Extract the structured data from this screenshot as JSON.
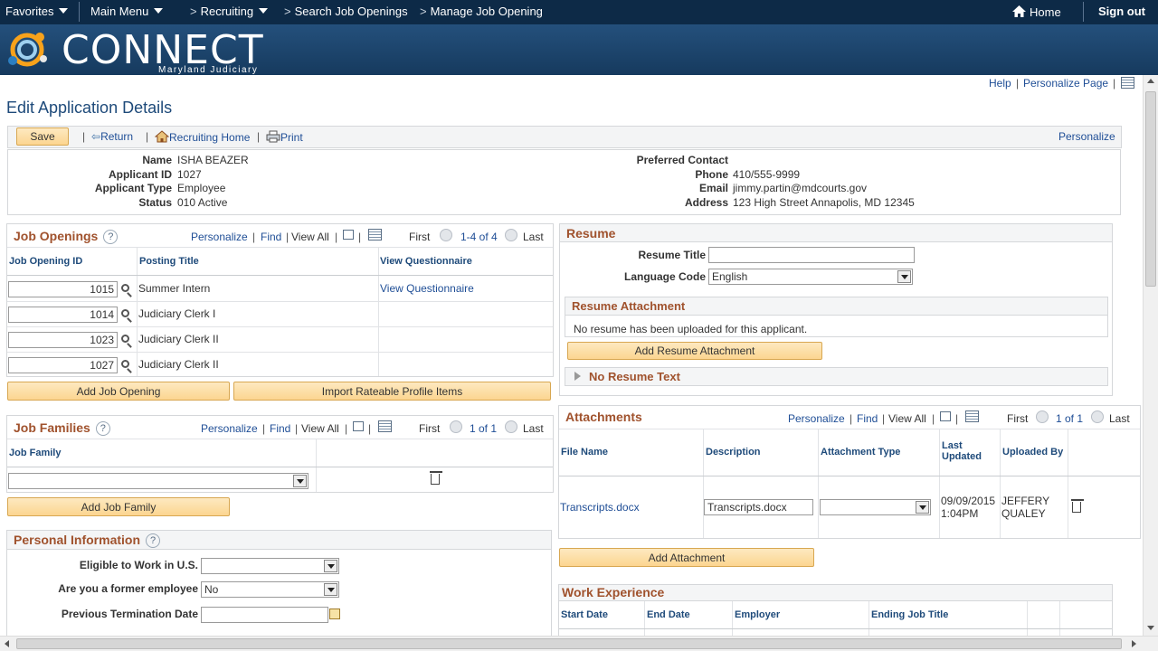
{
  "topnav": {
    "favorites": "Favorites",
    "main_menu": "Main Menu",
    "recruiting": "Recruiting",
    "search_job_openings": "Search Job Openings",
    "manage_job_opening": "Manage Job Opening",
    "home": "Home",
    "sign_out": "Sign out",
    "chevron": ">"
  },
  "banner": {
    "logo": "CONNECT",
    "sub": "Maryland Judiciary"
  },
  "header": {
    "help": "Help",
    "personalize_page": "Personalize Page",
    "title": "Edit Application Details"
  },
  "toolbar": {
    "save": "Save",
    "return": "Return",
    "recruiting_home": "Recruiting Home",
    "print": "Print",
    "personalize": "Personalize"
  },
  "applicant": {
    "name_label": "Name",
    "name": "ISHA BEAZER",
    "id_label": "Applicant ID",
    "id": "1027",
    "type_label": "Applicant Type",
    "type": "Employee",
    "status_label": "Status",
    "status": "010 Active",
    "preferred_label": "Preferred Contact",
    "phone_label": "Phone",
    "phone": "410/555-9999",
    "email_label": "Email",
    "email": "jimmy.partin@mdcourts.gov",
    "address_label": "Address",
    "address": "123 High Street Annapolis, MD 12345"
  },
  "grid_nav": {
    "personalize": "Personalize",
    "find": "Find",
    "view_all": "View All",
    "first": "First",
    "last": "Last",
    "pipe": "|"
  },
  "job_openings": {
    "title": "Job Openings",
    "range": "1-4 of 4",
    "col_id": "Job Opening ID",
    "col_title": "Posting Title",
    "col_q": "View Questionnaire",
    "rows": [
      {
        "id": "1015",
        "title": "Summer Intern",
        "q": "View Questionnaire"
      },
      {
        "id": "1014",
        "title": "Judiciary Clerk I",
        "q": ""
      },
      {
        "id": "1023",
        "title": "Judiciary Clerk II",
        "q": ""
      },
      {
        "id": "1027",
        "title": "Judiciary Clerk II",
        "q": ""
      }
    ],
    "add_btn": "Add Job Opening",
    "import_btn": "Import Rateable Profile Items"
  },
  "job_families": {
    "title": "Job Families",
    "range": "1 of 1",
    "col": "Job Family",
    "add_btn": "Add Job Family"
  },
  "personal": {
    "title": "Personal Information",
    "eligible_label": "Eligible to Work in U.S.",
    "eligible": "",
    "former_label": "Are you a former employee",
    "former": "No",
    "term_label": "Previous Termination Date",
    "term": ""
  },
  "resume": {
    "title": "Resume",
    "title_label": "Resume Title",
    "title_value": "",
    "lang_label": "Language Code",
    "lang": "English",
    "attach_title": "Resume Attachment",
    "no_resume": "No resume has been uploaded for this applicant.",
    "add_btn": "Add Resume Attachment",
    "no_text": "No Resume Text"
  },
  "attachments": {
    "title": "Attachments",
    "range": "1 of 1",
    "col_file": "File Name",
    "col_desc": "Description",
    "col_type": "Attachment Type",
    "col_updated": "Last Updated",
    "col_by": "Uploaded By",
    "file": "Transcripts.docx",
    "desc": "Transcripts.docx",
    "type": "",
    "date": "09/09/2015",
    "time": "1:04PM",
    "by1": "JEFFERY",
    "by2": "QUALEY",
    "add_btn": "Add Attachment"
  },
  "work": {
    "title": "Work Experience",
    "col_start": "Start Date",
    "col_end": "End Date",
    "col_employer": "Employer",
    "col_title": "Ending Job Title"
  },
  "colors": {
    "nav": "#0d2a47",
    "accent": "#a0522d",
    "link": "#1f4e96",
    "button": "#fcd590"
  }
}
